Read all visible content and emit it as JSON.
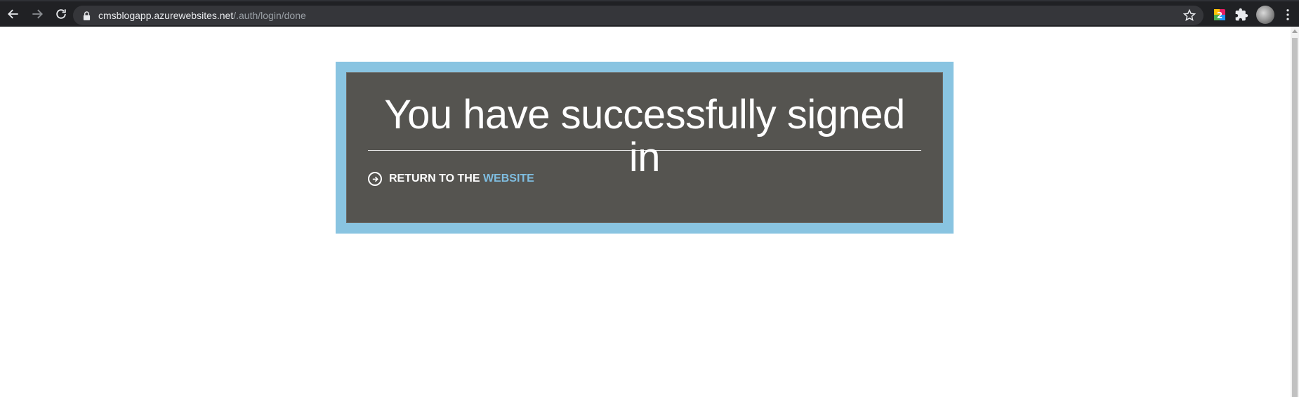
{
  "browser": {
    "url_host": "cmsblogapp.azurewebsites.net",
    "url_path": "/.auth/login/done"
  },
  "page": {
    "headline": "You have successfully signed in",
    "return_link": {
      "prefix": "RETURN TO THE",
      "accent": "WEBSITE"
    }
  },
  "colors": {
    "frame": "#89c4e1",
    "panel": "#555450",
    "accent": "#7fbde0"
  },
  "icons": [
    "back-icon",
    "forward-icon",
    "reload-icon",
    "lock-icon",
    "star-icon",
    "extension-icon",
    "puzzle-icon",
    "avatar",
    "menu-icon",
    "arrow-circle-icon"
  ]
}
